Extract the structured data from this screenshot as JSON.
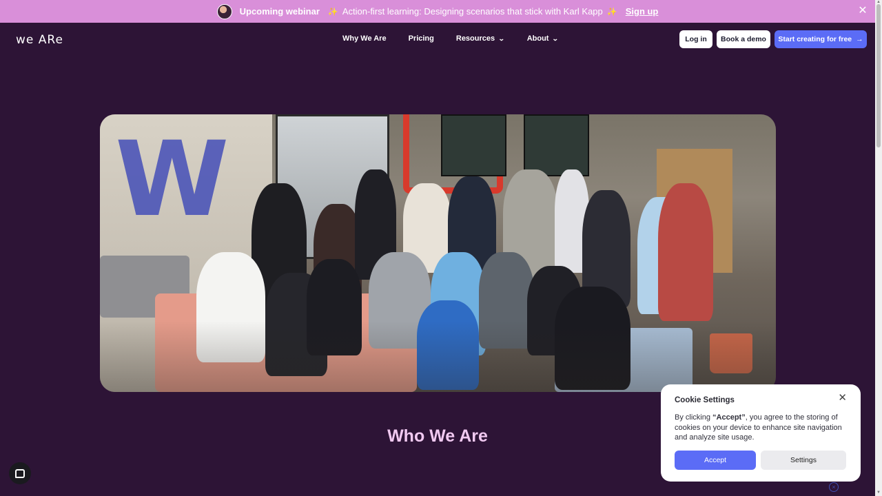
{
  "announcement": {
    "label": "Upcoming webinar",
    "spark": "✨",
    "text": "Action-first learning: Designing scenarios that stick with Karl Kapp",
    "signup": "Sign up",
    "close": "✕"
  },
  "nav": {
    "logo": "we ARe",
    "links": [
      {
        "label": "Why We Are"
      },
      {
        "label": "Pricing"
      },
      {
        "label": "Resources"
      },
      {
        "label": "About"
      }
    ],
    "chevron": "⌄",
    "login": "Log in",
    "demo": "Book a demo",
    "cta": "Start creating for free",
    "cta_arrow": "→"
  },
  "main": {
    "heading": "Who We Are"
  },
  "cookie": {
    "title": "Cookie Settings",
    "close": "✕",
    "text_pre": "By clicking ",
    "text_bold": "“Accept”",
    "text_post": ", you agree to the storing of cookies on your device to enhance site navigation and analyze site usage.",
    "accept": "Accept",
    "settings": "Settings"
  },
  "colors": {
    "background": "#2d1436",
    "banner": "#d98fd9",
    "accent": "#5b6cf6",
    "heading": "#f1c9f1"
  },
  "icons": {
    "chat": "chat-icon",
    "close": "close-icon",
    "chevron": "chevron-down-icon",
    "arrow": "arrow-right-icon"
  }
}
